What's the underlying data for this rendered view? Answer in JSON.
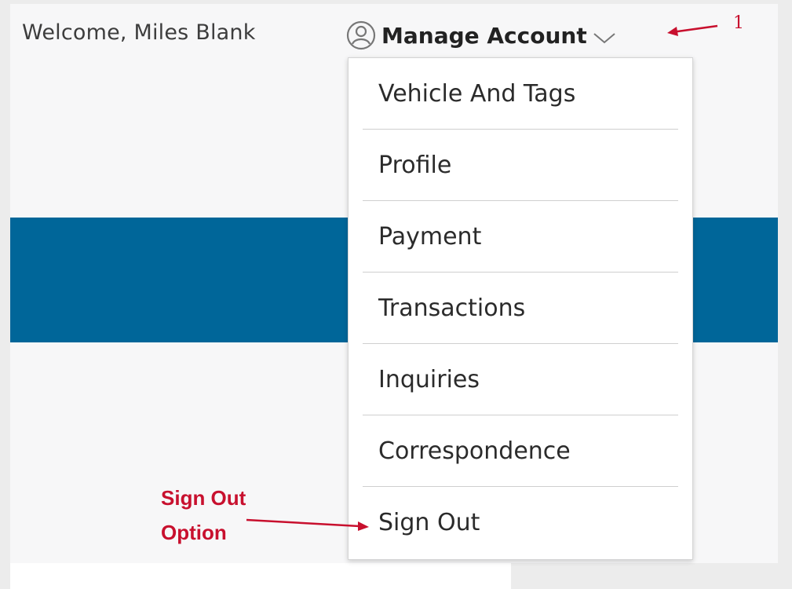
{
  "header": {
    "welcome_text": "Welcome, Miles Blank",
    "manage_account_label": "Manage Account",
    "user_icon": "user-circle-icon",
    "chevron_icon": "chevron-down-icon"
  },
  "dropdown": {
    "items": [
      {
        "label": "Vehicle And Tags"
      },
      {
        "label": "Profile"
      },
      {
        "label": "Payment"
      },
      {
        "label": "Transactions"
      },
      {
        "label": "Inquiries"
      },
      {
        "label": "Correspondence"
      },
      {
        "label": "Sign Out"
      }
    ]
  },
  "annotations": {
    "step_number": "1",
    "sign_out_note": "Sign Out\nOption",
    "color": "#c8102e"
  },
  "colors": {
    "blue_band": "#006699",
    "page_background": "#f7f7f8",
    "outer_background": "#ececec"
  }
}
